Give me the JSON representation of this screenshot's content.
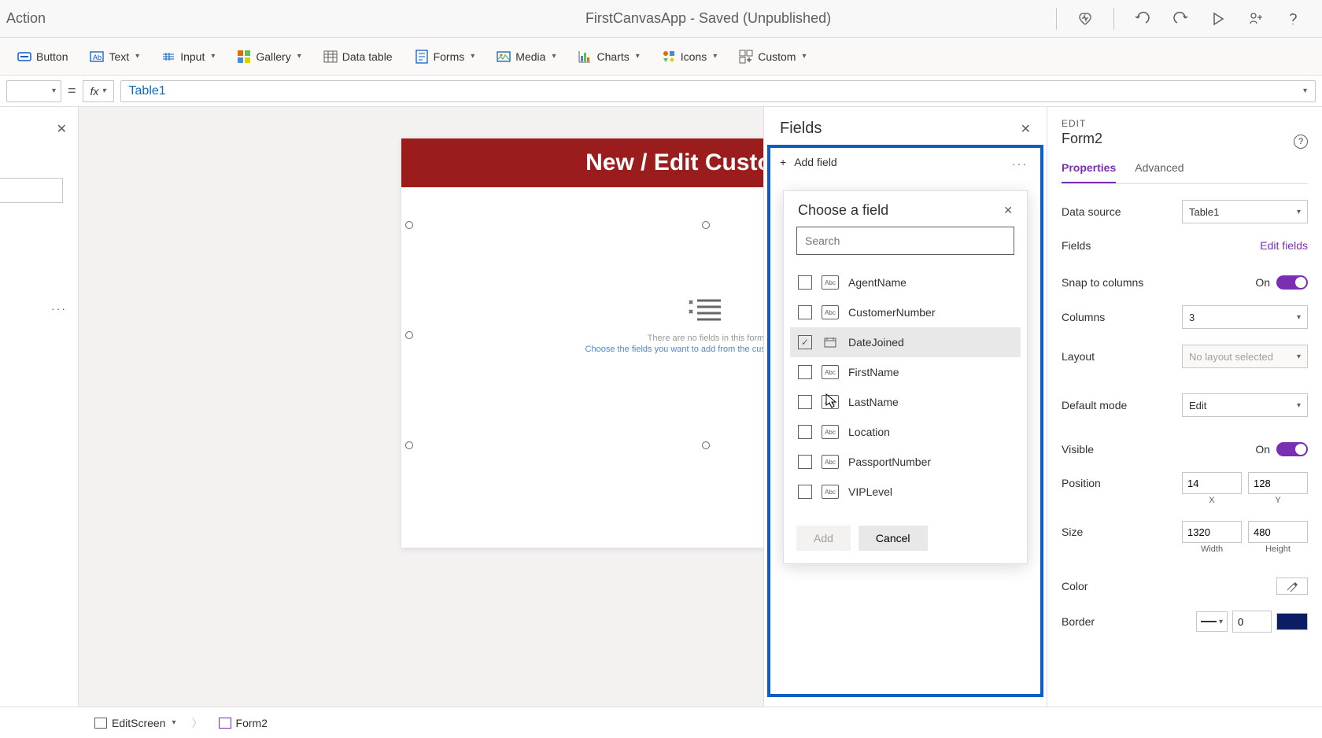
{
  "titlebar": {
    "action": "Action",
    "center": "FirstCanvasApp - Saved (Unpublished)"
  },
  "ribbon": {
    "button": "Button",
    "text": "Text",
    "input": "Input",
    "gallery": "Gallery",
    "datatable": "Data table",
    "forms": "Forms",
    "media": "Media",
    "charts": "Charts",
    "icons": "Icons",
    "custom": "Custom"
  },
  "formula": {
    "value": "Table1"
  },
  "canvas": {
    "banner": "New / Edit Customer",
    "placeholder1": "There are no fields in this form",
    "placeholder2": "Choose the fields you want to add from the customization pane"
  },
  "fieldsPanel": {
    "title": "Fields",
    "addField": "Add field",
    "chooseTitle": "Choose a field",
    "searchPlaceholder": "Search",
    "addBtn": "Add",
    "cancelBtn": "Cancel",
    "items": [
      {
        "name": "AgentName",
        "type": "Abc",
        "checked": false
      },
      {
        "name": "CustomerNumber",
        "type": "Abc",
        "checked": false
      },
      {
        "name": "DateJoined",
        "type": "date",
        "checked": true
      },
      {
        "name": "FirstName",
        "type": "Abc",
        "checked": false
      },
      {
        "name": "LastName",
        "type": "Abc",
        "checked": false
      },
      {
        "name": "Location",
        "type": "Abc",
        "checked": false
      },
      {
        "name": "PassportNumber",
        "type": "Abc",
        "checked": false
      },
      {
        "name": "VIPLevel",
        "type": "Abc",
        "checked": false
      }
    ]
  },
  "props": {
    "editLabel": "EDIT",
    "formName": "Form2",
    "tabs": {
      "properties": "Properties",
      "advanced": "Advanced"
    },
    "dataSource": {
      "label": "Data source",
      "value": "Table1"
    },
    "fields": {
      "label": "Fields",
      "link": "Edit fields"
    },
    "snap": {
      "label": "Snap to columns",
      "value": "On"
    },
    "columns": {
      "label": "Columns",
      "value": "3"
    },
    "layout": {
      "label": "Layout",
      "value": "No layout selected"
    },
    "defaultMode": {
      "label": "Default mode",
      "value": "Edit"
    },
    "visible": {
      "label": "Visible",
      "value": "On"
    },
    "position": {
      "label": "Position",
      "x": "14",
      "y": "128",
      "xl": "X",
      "yl": "Y"
    },
    "size": {
      "label": "Size",
      "w": "1320",
      "h": "480",
      "wl": "Width",
      "hl": "Height"
    },
    "color": {
      "label": "Color"
    },
    "border": {
      "label": "Border",
      "value": "0",
      "color": "#0b1e63"
    }
  },
  "breadcrumb": {
    "screen": "EditScreen",
    "form": "Form2"
  }
}
